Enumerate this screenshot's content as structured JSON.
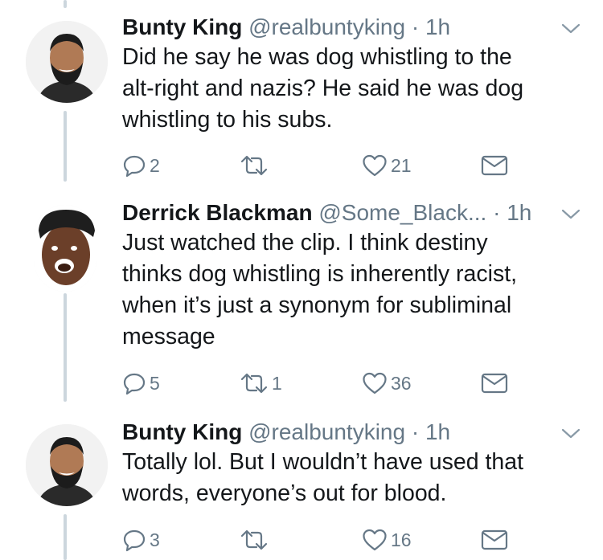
{
  "tweets": [
    {
      "name": "Bunty King",
      "handle": "@realbuntyking",
      "dot": "·",
      "time": "1h",
      "text_lines": [
        "Did he say he was dog whistling to the",
        "alt-right and nazis? He said he was dog",
        "whistling to his subs."
      ],
      "replies": "2",
      "retweets": "",
      "likes": "21",
      "icons": {
        "reply": "reply-icon",
        "retweet": "retweet-icon",
        "like": "heart-icon",
        "message": "envelope-icon",
        "menu": "chevron-down-icon"
      }
    },
    {
      "name": "Derrick Blackman",
      "handle": "@Some_Black...",
      "dot": "·",
      "time": "1h",
      "text_lines": [
        "Just watched the clip. I think destiny",
        "thinks dog whistling is inherently racist,",
        "when it’s just a synonym for subliminal",
        "message"
      ],
      "replies": "5",
      "retweets": "1",
      "likes": "36",
      "icons": {
        "reply": "reply-icon",
        "retweet": "retweet-icon",
        "like": "heart-icon",
        "message": "envelope-icon",
        "menu": "chevron-down-icon"
      }
    },
    {
      "name": "Bunty King",
      "handle": "@realbuntyking",
      "dot": "·",
      "time": "1h",
      "text_lines": [
        "Totally lol. But I wouldn’t have used that",
        "words, everyone’s out for blood."
      ],
      "replies": "3",
      "retweets": "",
      "likes": "16",
      "icons": {
        "reply": "reply-icon",
        "retweet": "retweet-icon",
        "like": "heart-icon",
        "message": "envelope-icon",
        "menu": "chevron-down-icon"
      }
    }
  ],
  "colors": {
    "text": "#14171a",
    "secondary": "#657786",
    "thread_line": "#ccd6dd"
  }
}
